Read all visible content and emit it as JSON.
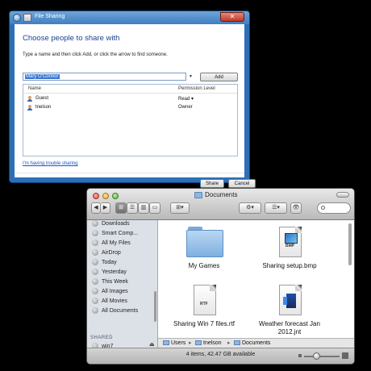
{
  "file_sharing_dialog": {
    "title": "File Sharing",
    "heading": "Choose people to share with",
    "instructions": "Type a name and then click Add, or click the arrow to find someone.",
    "name_input_value": "Mary O'Connor",
    "add_label": "Add",
    "table": {
      "columns": [
        "Name",
        "Permission Level"
      ],
      "rows": [
        {
          "name": "Guest",
          "permission": "Read ▾"
        },
        {
          "name": "tnelson",
          "permission": "Owner"
        }
      ]
    },
    "trouble_link": "I'm having trouble sharing",
    "share_label": "Share",
    "cancel_label": "Cancel",
    "close_glyph": "✕"
  },
  "finder": {
    "title": "Documents",
    "toolbar": {
      "back": "◀",
      "forward": "▶",
      "view_icon": "⊞",
      "view_list": "☰",
      "view_column": "▥",
      "view_flow": "▭",
      "arrange": "⊞▾",
      "action": "⚙▾",
      "share": "☰▾",
      "quicklook": "👁"
    },
    "sidebar": {
      "items": [
        {
          "label": "Downloads",
          "icon": "downloads-icon"
        },
        {
          "label": "Smart Comp...",
          "icon": "smart-folder-icon"
        },
        {
          "label": "All My Files",
          "icon": "all-files-icon"
        },
        {
          "label": "AirDrop",
          "icon": "airdrop-icon"
        },
        {
          "label": "Today",
          "icon": "gear-icon"
        },
        {
          "label": "Yesterday",
          "icon": "gear-icon"
        },
        {
          "label": "This Week",
          "icon": "gear-icon"
        },
        {
          "label": "All Images",
          "icon": "gear-icon"
        },
        {
          "label": "All Movies",
          "icon": "gear-icon"
        },
        {
          "label": "All Documents",
          "icon": "gear-icon"
        }
      ],
      "shared_heading": "SHARED",
      "shared_items": [
        {
          "label": "win7",
          "icon": "pc-icon"
        }
      ],
      "eject_glyph": "⏏"
    },
    "files": [
      {
        "name": "My Games",
        "kind": "folder"
      },
      {
        "name": "Sharing setup.bmp",
        "kind": "document",
        "badge": "BMP"
      },
      {
        "name": "Sharing Win 7 files.rtf",
        "kind": "document",
        "badge": "RTF"
      },
      {
        "name": "Weather forecast Jan 2012.jnt",
        "kind": "document",
        "badge": ""
      }
    ],
    "path": [
      "Users",
      "tnelson",
      "Documents"
    ],
    "path_separator": "▸",
    "status": "4 items, 42.47 GB available"
  }
}
